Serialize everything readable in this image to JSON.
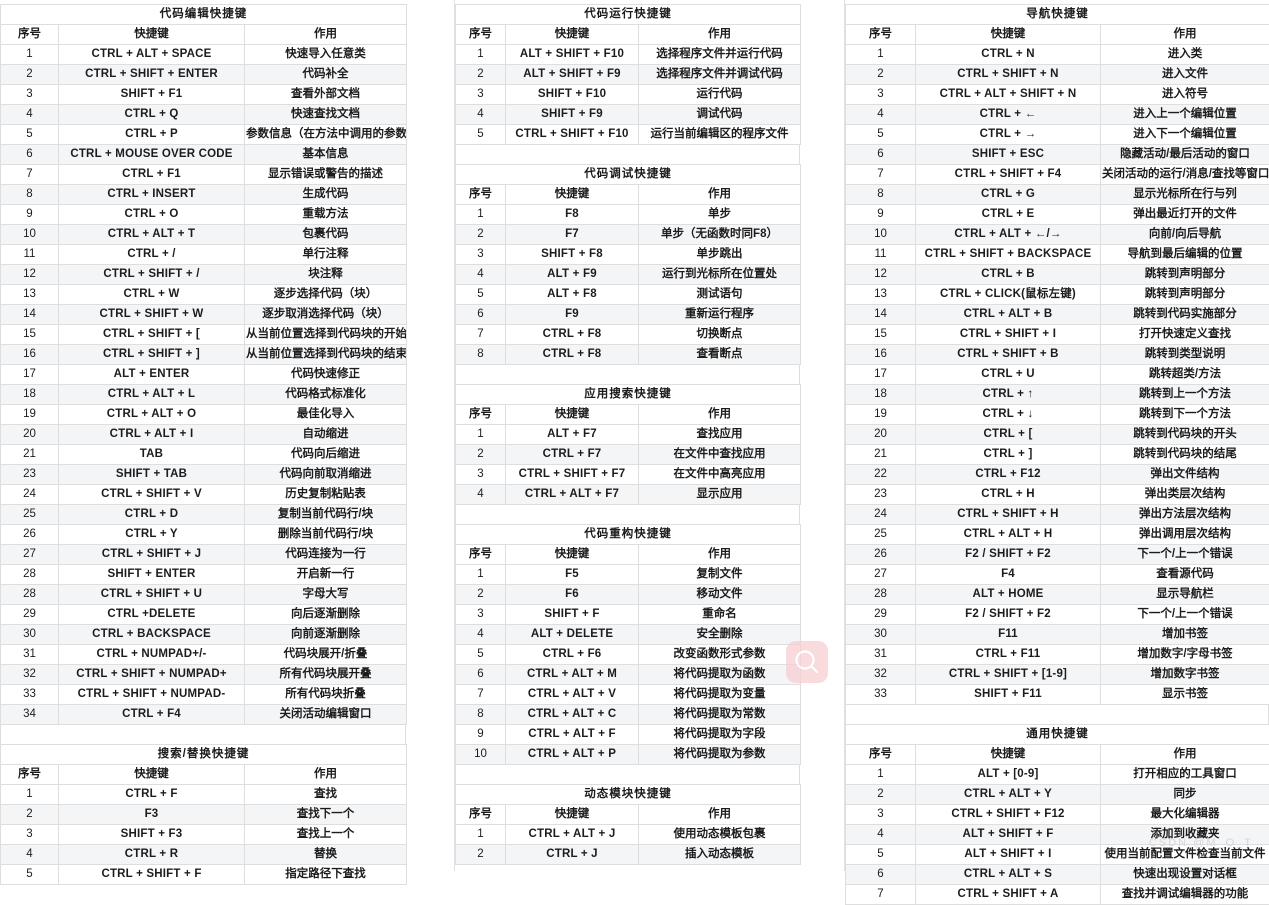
{
  "watermarks": {
    "logo_icon": "search-icon",
    "text": "CSDN @M_O_T"
  },
  "columns": {
    "headers": {
      "no": "序号",
      "key": "快捷键",
      "action": "作用"
    }
  },
  "sections": {
    "code_edit": {
      "title": "代码编辑快捷键",
      "rows": [
        [
          "1",
          "CTRL + ALT + SPACE",
          "快速导入任意类"
        ],
        [
          "2",
          "CTRL + SHIFT + ENTER",
          "代码补全"
        ],
        [
          "3",
          "SHIFT + F1",
          "查看外部文档"
        ],
        [
          "4",
          "CTRL + Q",
          "快速查找文档"
        ],
        [
          "5",
          "CTRL + P",
          "参数信息（在方法中调用的参数）"
        ],
        [
          "6",
          "CTRL + MOUSE OVER CODE",
          "基本信息"
        ],
        [
          "7",
          "CTRL + F1",
          "显示错误或警告的描述"
        ],
        [
          "8",
          "CTRL + INSERT",
          "生成代码"
        ],
        [
          "9",
          "CTRL + O",
          "重载方法"
        ],
        [
          "10",
          "CTRL + ALT + T",
          "包裹代码"
        ],
        [
          "11",
          "CTRL + /",
          "单行注释"
        ],
        [
          "12",
          "CTRL + SHIFT + /",
          "块注释"
        ],
        [
          "13",
          "CTRL + W",
          "逐步选择代码（块）"
        ],
        [
          "14",
          "CTRL + SHIFT + W",
          "逐步取消选择代码（块）"
        ],
        [
          "15",
          "CTRL + SHIFT + [",
          "从当前位置选择到代码块的开始"
        ],
        [
          "16",
          "CTRL + SHIFT + ]",
          "从当前位置选择到代码块的结束"
        ],
        [
          "17",
          "ALT + ENTER",
          "代码快速修正"
        ],
        [
          "18",
          "CTRL + ALT + L",
          "代码格式标准化"
        ],
        [
          "19",
          "CTRL + ALT + O",
          "最佳化导入"
        ],
        [
          "20",
          "CTRL + ALT + I",
          "自动缩进"
        ],
        [
          "21",
          "TAB",
          "代码向后缩进"
        ],
        [
          "23",
          "SHIFT + TAB",
          "代码向前取消缩进"
        ],
        [
          "24",
          "CTRL + SHIFT + V",
          "历史复制粘贴表"
        ],
        [
          "25",
          "CTRL + D",
          "复制当前代码行/块"
        ],
        [
          "26",
          "CTRL + Y",
          "删除当前代码行/块"
        ],
        [
          "27",
          "CTRL + SHIFT + J",
          "代码连接为一行"
        ],
        [
          "28",
          "SHIFT + ENTER",
          "开启新一行"
        ],
        [
          "28",
          "CTRL + SHIFT + U",
          "字母大写"
        ],
        [
          "29",
          "CTRL +DELETE",
          "向后逐渐删除"
        ],
        [
          "30",
          "CTRL + BACKSPACE",
          "向前逐渐删除"
        ],
        [
          "31",
          "CTRL + NUMPAD+/-",
          "代码块展开/折叠"
        ],
        [
          "32",
          "CTRL + SHIFT + NUMPAD+",
          "所有代码块展开叠"
        ],
        [
          "33",
          "CTRL + SHIFT + NUMPAD-",
          "所有代码块折叠"
        ],
        [
          "34",
          "CTRL + F4",
          "关闭活动编辑窗口"
        ]
      ]
    },
    "search_replace": {
      "title": "搜索/替换快捷键",
      "rows": [
        [
          "1",
          "CTRL + F",
          "查找"
        ],
        [
          "2",
          "F3",
          "查找下一个"
        ],
        [
          "3",
          "SHIFT + F3",
          "查找上一个"
        ],
        [
          "4",
          "CTRL + R",
          "替换"
        ],
        [
          "5",
          "CTRL + SHIFT + F",
          "指定路径下查找"
        ]
      ]
    },
    "code_run": {
      "title": "代码运行快捷键",
      "rows": [
        [
          "1",
          "ALT + SHIFT + F10",
          "选择程序文件并运行代码"
        ],
        [
          "2",
          "ALT + SHIFT + F9",
          "选择程序文件并调试代码"
        ],
        [
          "3",
          "SHIFT + F10",
          "运行代码"
        ],
        [
          "4",
          "SHIFT + F9",
          "调试代码"
        ],
        [
          "5",
          "CTRL + SHIFT + F10",
          "运行当前编辑区的程序文件"
        ]
      ]
    },
    "code_debug": {
      "title": "代码调试快捷键",
      "rows": [
        [
          "1",
          "F8",
          "单步"
        ],
        [
          "2",
          "F7",
          "单步（无函数时同F8）"
        ],
        [
          "3",
          "SHIFT + F8",
          "单步跳出"
        ],
        [
          "4",
          "ALT + F9",
          "运行到光标所在位置处"
        ],
        [
          "5",
          "ALT + F8",
          "测试语句"
        ],
        [
          "6",
          "F9",
          "重新运行程序"
        ],
        [
          "7",
          "CTRL + F8",
          "切换断点"
        ],
        [
          "8",
          "CTRL + F8",
          "查看断点"
        ]
      ]
    },
    "app_search": {
      "title": "应用搜索快捷键",
      "rows": [
        [
          "1",
          "ALT + F7",
          "查找应用"
        ],
        [
          "2",
          "CTRL + F7",
          "在文件中查找应用"
        ],
        [
          "3",
          "CTRL + SHIFT + F7",
          "在文件中高亮应用"
        ],
        [
          "4",
          "CTRL + ALT + F7",
          "显示应用"
        ]
      ]
    },
    "refactor": {
      "title": "代码重构快捷键",
      "rows": [
        [
          "1",
          "F5",
          "复制文件"
        ],
        [
          "2",
          "F6",
          "移动文件"
        ],
        [
          "3",
          "SHIFT + F",
          "重命名"
        ],
        [
          "4",
          "ALT + DELETE",
          "安全删除"
        ],
        [
          "5",
          "CTRL + F6",
          "改变函数形式参数"
        ],
        [
          "6",
          "CTRL + ALT + M",
          "将代码提取为函数"
        ],
        [
          "7",
          "CTRL + ALT + V",
          "将代码提取为变量"
        ],
        [
          "8",
          "CTRL + ALT + C",
          "将代码提取为常数"
        ],
        [
          "9",
          "CTRL + ALT + F",
          "将代码提取为字段"
        ],
        [
          "10",
          "CTRL + ALT + P",
          "将代码提取为参数"
        ]
      ]
    },
    "live_template": {
      "title": "动态模块快捷键",
      "rows": [
        [
          "1",
          "CTRL + ALT + J",
          "使用动态模板包裹"
        ],
        [
          "2",
          "CTRL + J",
          "插入动态模板"
        ]
      ]
    },
    "navigation": {
      "title": "导航快捷键",
      "rows": [
        [
          "1",
          "CTRL + N",
          "进入类"
        ],
        [
          "2",
          "CTRL + SHIFT + N",
          "进入文件"
        ],
        [
          "3",
          "CTRL + ALT + SHIFT + N",
          "进入符号"
        ],
        [
          "4",
          "CTRL + ←",
          "进入上一个编辑位置"
        ],
        [
          "5",
          "CTRL + →",
          "进入下一个编辑位置"
        ],
        [
          "6",
          "SHIFT + ESC",
          "隐藏活动/最后活动的窗口"
        ],
        [
          "7",
          "CTRL + SHIFT + F4",
          "关闭活动的运行/消息/查找等窗口"
        ],
        [
          "8",
          "CTRL + G",
          "显示光标所在行与列"
        ],
        [
          "9",
          "CTRL + E",
          "弹出最近打开的文件"
        ],
        [
          "10",
          "CTRL + ALT + ←/→",
          "向前/向后导航"
        ],
        [
          "11",
          "CTRL + SHIFT + BACKSPACE",
          "导航到最后编辑的位置"
        ],
        [
          "12",
          "CTRL + B",
          "跳转到声明部分"
        ],
        [
          "13",
          "CTRL + CLICK(鼠标左键)",
          "跳转到声明部分"
        ],
        [
          "14",
          "CTRL + ALT + B",
          "跳转到代码实施部分"
        ],
        [
          "15",
          "CTRL + SHIFT + I",
          "打开快速定义查找"
        ],
        [
          "16",
          "CTRL + SHIFT + B",
          "跳转到类型说明"
        ],
        [
          "17",
          "CTRL + U",
          "跳转超类/方法"
        ],
        [
          "18",
          "CTRL + ↑",
          "跳转到上一个方法"
        ],
        [
          "19",
          "CTRL + ↓",
          "跳转到下一个方法"
        ],
        [
          "20",
          "CTRL + [",
          "跳转到代码块的开头"
        ],
        [
          "21",
          "CTRL + ]",
          "跳转到代码块的结尾"
        ],
        [
          "22",
          "CTRL + F12",
          "弹出文件结构"
        ],
        [
          "23",
          "CTRL + H",
          "弹出类层次结构"
        ],
        [
          "24",
          "CTRL + SHIFT + H",
          "弹出方法层次结构"
        ],
        [
          "25",
          "CTRL + ALT + H",
          "弹出调用层次结构"
        ],
        [
          "26",
          "F2 / SHIFT + F2",
          "下一个/上一个错误"
        ],
        [
          "27",
          "F4",
          "查看源代码"
        ],
        [
          "28",
          "ALT + HOME",
          "显示导航栏"
        ],
        [
          "29",
          "F2 / SHIFT + F2",
          "下一个/上一个错误"
        ],
        [
          "30",
          "F11",
          "增加书签"
        ],
        [
          "31",
          "CTRL + F11",
          "增加数字/字母书签"
        ],
        [
          "32",
          "CTRL + SHIFT + [1-9]",
          "增加数字书签"
        ],
        [
          "33",
          "SHIFT + F11",
          "显示书签"
        ]
      ]
    },
    "general": {
      "title": "通用快捷键",
      "rows": [
        [
          "1",
          "ALT + [0-9]",
          "打开相应的工具窗口"
        ],
        [
          "2",
          "CTRL + ALT + Y",
          "同步"
        ],
        [
          "3",
          "CTRL + SHIFT + F12",
          "最大化编辑器"
        ],
        [
          "4",
          "ALT + SHIFT + F",
          "添加到收藏夹"
        ],
        [
          "5",
          "ALT + SHIFT + I",
          "使用当前配置文件检查当前文件"
        ],
        [
          "6",
          "CTRL + ALT + S",
          "快速出现设置对话框"
        ],
        [
          "7",
          "CTRL + SHIFT + A",
          "查找并调试编辑器的功能"
        ]
      ]
    }
  }
}
